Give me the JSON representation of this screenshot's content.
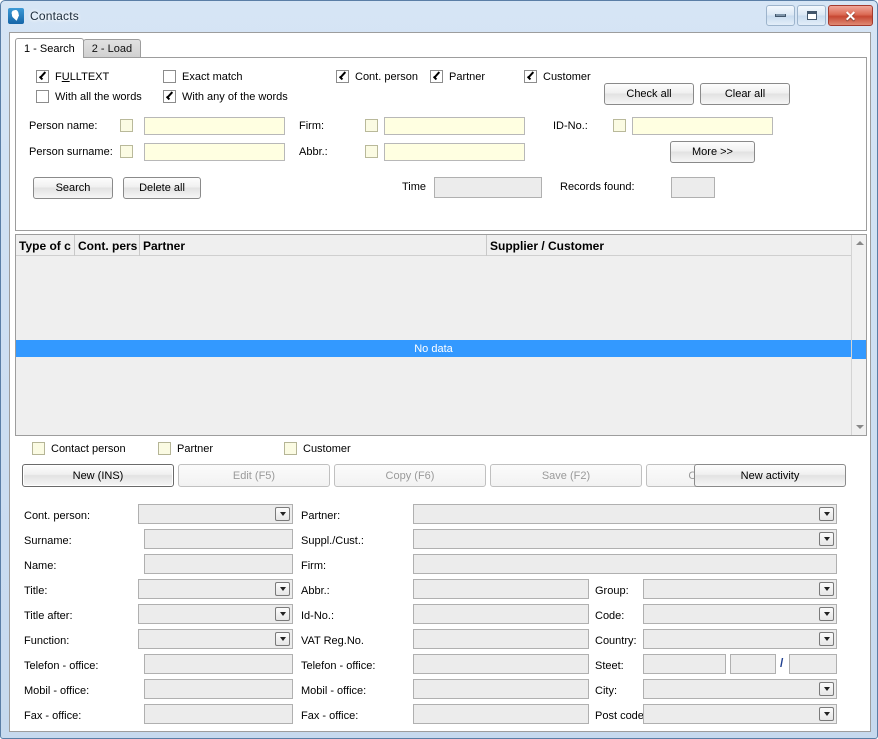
{
  "window": {
    "title": "Contacts",
    "icon": "contacts-app-icon",
    "controls": {
      "minimize": "minimize",
      "maximize": "maximize",
      "close": "close"
    }
  },
  "tabs": [
    {
      "label": "1 - Search",
      "active": true
    },
    {
      "label": "2 - Load",
      "active": false
    }
  ],
  "search": {
    "option_checkboxes": [
      {
        "label": "FULLTEXT",
        "checked": true
      },
      {
        "label": "Exact match",
        "checked": false
      },
      {
        "label": "Cont. person",
        "checked": true
      },
      {
        "label": "Partner",
        "checked": true
      },
      {
        "label": "Customer",
        "checked": true
      },
      {
        "label": "With all the words",
        "checked": false
      },
      {
        "label": "With any of the words",
        "checked": true
      }
    ],
    "check_all_label": "Check all",
    "clear_all_label": "Clear all",
    "more_label": "More >>",
    "fields": [
      {
        "label": "Person name:",
        "value": "",
        "checked": false
      },
      {
        "label": "Person surname:",
        "value": "",
        "checked": false
      },
      {
        "label": "Firm:",
        "value": "",
        "checked": false
      },
      {
        "label": "Abbr.:",
        "value": "",
        "checked": false
      },
      {
        "label": "ID-No.:",
        "value": "",
        "checked": false
      }
    ],
    "search_button": "Search",
    "delete_all_button": "Delete all",
    "time_label": "Time",
    "time_value": "",
    "records_found_label": "Records found:",
    "records_found_value": ""
  },
  "grid": {
    "columns": [
      "Type of c",
      "Cont. pers",
      "Partner",
      "Supplier / Customer"
    ],
    "empty_text": "No data",
    "rows": []
  },
  "record_type_checkboxes": [
    {
      "label": "Contact person",
      "checked": false
    },
    {
      "label": "Partner",
      "checked": false
    },
    {
      "label": "Customer",
      "checked": false
    }
  ],
  "actions": [
    {
      "label": "New (INS)",
      "enabled": true,
      "default": true
    },
    {
      "label": "Edit (F5)",
      "enabled": false
    },
    {
      "label": "Copy (F6)",
      "enabled": false
    },
    {
      "label": "Save (F2)",
      "enabled": false
    },
    {
      "label": "Cancel (ESC)",
      "enabled": false
    },
    {
      "label": "New activity",
      "enabled": true
    }
  ],
  "detail": {
    "left": [
      {
        "label": "Cont. person:",
        "type": "combo",
        "value": ""
      },
      {
        "label": "Surname:",
        "type": "text",
        "value": ""
      },
      {
        "label": "Name:",
        "type": "text",
        "value": ""
      },
      {
        "label": "Title:",
        "type": "combo",
        "value": ""
      },
      {
        "label": "Title after:",
        "type": "combo",
        "value": ""
      },
      {
        "label": "Function:",
        "type": "combo",
        "value": ""
      },
      {
        "label": "Telefon - office:",
        "type": "text",
        "value": ""
      },
      {
        "label": "Mobil - office:",
        "type": "text",
        "value": ""
      },
      {
        "label": "Fax - office:",
        "type": "text",
        "value": ""
      }
    ],
    "middle": [
      {
        "label": "Partner:",
        "type": "combo",
        "value": ""
      },
      {
        "label": "Suppl./Cust.:",
        "type": "combo",
        "value": ""
      },
      {
        "label": "Firm:",
        "type": "text",
        "value": ""
      },
      {
        "label": "Abbr.:",
        "type": "text",
        "value": ""
      },
      {
        "label": "Id-No.:",
        "type": "text",
        "value": ""
      },
      {
        "label": "VAT Reg.No.",
        "type": "text",
        "value": ""
      },
      {
        "label": "Telefon - office:",
        "type": "text",
        "value": ""
      },
      {
        "label": "Mobil - office:",
        "type": "text",
        "value": ""
      },
      {
        "label": "Fax - office:",
        "type": "text",
        "value": ""
      }
    ],
    "right": [
      {
        "label": "Group:",
        "type": "combo",
        "value": ""
      },
      {
        "label": "Code:",
        "type": "combo",
        "value": ""
      },
      {
        "label": "Country:",
        "type": "combo",
        "value": ""
      },
      {
        "label": "Steet:",
        "type": "street",
        "value": "",
        "value2": "",
        "value3": "",
        "separator": "/"
      },
      {
        "label": "City:",
        "type": "combo",
        "value": ""
      },
      {
        "label": "Post code:",
        "type": "combo",
        "value": ""
      }
    ]
  },
  "colors": {
    "selection": "#3399ff",
    "input_cream": "#ffffe1",
    "input_gray": "#ececec",
    "frame": "#cfe0f2"
  }
}
